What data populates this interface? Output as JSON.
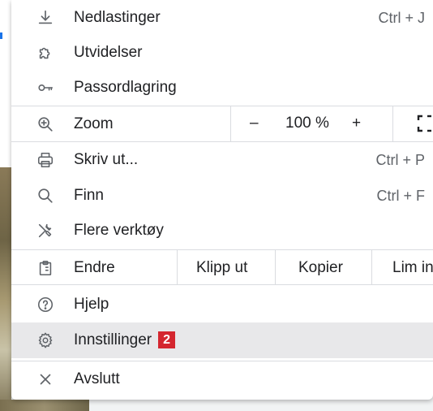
{
  "menu": {
    "downloads": {
      "label": "Nedlastinger",
      "shortcut": "Ctrl + J"
    },
    "extensions": {
      "label": "Utvidelser"
    },
    "passwords": {
      "label": "Passordlagring"
    },
    "zoom": {
      "label": "Zoom",
      "minus": "–",
      "value": "100 %",
      "plus": "+"
    },
    "print": {
      "label": "Skriv ut...",
      "shortcut": "Ctrl + P"
    },
    "find": {
      "label": "Finn",
      "shortcut": "Ctrl + F"
    },
    "more_tools": {
      "label": "Flere verktøy"
    },
    "edit": {
      "label": "Endre",
      "cut": "Klipp ut",
      "copy": "Kopier",
      "paste": "Lim in"
    },
    "help": {
      "label": "Hjelp"
    },
    "settings": {
      "label": "Innstillinger",
      "badge": "2"
    },
    "exit": {
      "label": "Avslutt"
    }
  },
  "colors": {
    "badge": "#d4262f",
    "hover": "#e8e8ea",
    "separator": "#dadce0"
  }
}
